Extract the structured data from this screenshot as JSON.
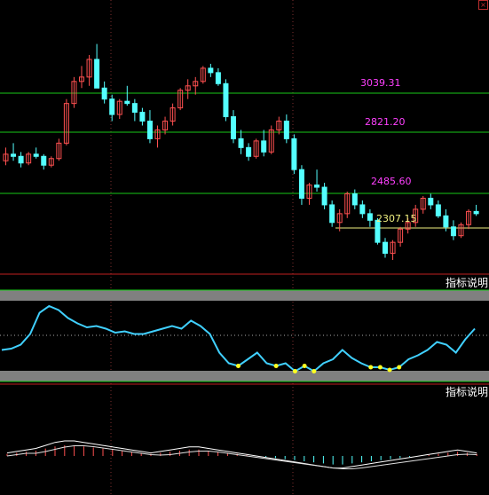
{
  "colors": {
    "background": "#000000",
    "up_candle": "#ff5050",
    "down_candle": "#54ffff",
    "support_line": "#18c818",
    "level_label": "#ff40ff",
    "current_line": "#f0f080",
    "current_label": "#f0f080",
    "panel_border": "#c02020",
    "indicator_line": "#40d0ff",
    "indicator_highlight": "#ffff20",
    "gray_band": "#808080",
    "macd_white": "#ffffff"
  },
  "window": {
    "close_icon": "close-icon"
  },
  "main_panel": {
    "price_levels": [
      {
        "label": "3039.31"
      },
      {
        "label": "2821.20"
      },
      {
        "label": "2485.60"
      }
    ],
    "current_level": {
      "label": "2307.15"
    }
  },
  "indicator_panel_1": {
    "label": "指标说明"
  },
  "indicator_panel_2": {
    "label": "指标说明"
  },
  "chart_data": [
    {
      "type": "candlestick",
      "horizontal_lines": [
        3039.31,
        2821.2,
        2485.6,
        2307.15
      ],
      "grid": true,
      "candles": [
        [
          2620,
          2680,
          2600,
          2650
        ],
        [
          2650,
          2700,
          2620,
          2640
        ],
        [
          2640,
          2660,
          2590,
          2610
        ],
        [
          2610,
          2660,
          2600,
          2650
        ],
        [
          2650,
          2680,
          2630,
          2640
        ],
        [
          2640,
          2650,
          2580,
          2600
        ],
        [
          2600,
          2640,
          2590,
          2630
        ],
        [
          2630,
          2720,
          2620,
          2700
        ],
        [
          2700,
          2900,
          2690,
          2880
        ],
        [
          2880,
          3000,
          2860,
          2980
        ],
        [
          2980,
          3050,
          2950,
          3000
        ],
        [
          3000,
          3100,
          2960,
          3080
        ],
        [
          3080,
          3150,
          3020,
          2950
        ],
        [
          2950,
          2980,
          2880,
          2900
        ],
        [
          2900,
          2920,
          2800,
          2830
        ],
        [
          2830,
          2900,
          2810,
          2890
        ],
        [
          2890,
          2960,
          2870,
          2880
        ],
        [
          2880,
          2900,
          2800,
          2840
        ],
        [
          2840,
          2860,
          2780,
          2800
        ],
        [
          2800,
          2850,
          2700,
          2720
        ],
        [
          2720,
          2780,
          2680,
          2760
        ],
        [
          2760,
          2820,
          2740,
          2800
        ],
        [
          2800,
          2880,
          2780,
          2860
        ],
        [
          2860,
          2950,
          2850,
          2940
        ],
        [
          2940,
          2990,
          2900,
          2960
        ],
        [
          2960,
          3000,
          2920,
          2980
        ],
        [
          2980,
          3050,
          2970,
          3040
        ],
        [
          3040,
          3060,
          3000,
          3020
        ],
        [
          3020,
          3040,
          2960,
          2970
        ],
        [
          2970,
          2990,
          2800,
          2820
        ],
        [
          2820,
          2850,
          2700,
          2720
        ],
        [
          2720,
          2760,
          2650,
          2680
        ],
        [
          2680,
          2700,
          2620,
          2640
        ],
        [
          2640,
          2720,
          2630,
          2710
        ],
        [
          2710,
          2760,
          2640,
          2660
        ],
        [
          2660,
          2780,
          2650,
          2760
        ],
        [
          2760,
          2820,
          2740,
          2800
        ],
        [
          2800,
          2830,
          2700,
          2720
        ],
        [
          2720,
          2740,
          2560,
          2580
        ],
        [
          2580,
          2600,
          2420,
          2450
        ],
        [
          2450,
          2520,
          2420,
          2510
        ],
        [
          2510,
          2580,
          2480,
          2500
        ],
        [
          2500,
          2520,
          2400,
          2420
        ],
        [
          2420,
          2440,
          2320,
          2340
        ],
        [
          2340,
          2400,
          2300,
          2380
        ],
        [
          2380,
          2480,
          2360,
          2470
        ],
        [
          2470,
          2490,
          2400,
          2420
        ],
        [
          2420,
          2440,
          2360,
          2380
        ],
        [
          2380,
          2400,
          2320,
          2350
        ],
        [
          2350,
          2360,
          2240,
          2250
        ],
        [
          2250,
          2270,
          2180,
          2200
        ],
        [
          2200,
          2260,
          2170,
          2250
        ],
        [
          2250,
          2320,
          2230,
          2310
        ],
        [
          2310,
          2360,
          2290,
          2340
        ],
        [
          2340,
          2420,
          2320,
          2400
        ],
        [
          2400,
          2460,
          2380,
          2450
        ],
        [
          2450,
          2470,
          2400,
          2420
        ],
        [
          2420,
          2440,
          2360,
          2370
        ],
        [
          2370,
          2400,
          2300,
          2320
        ],
        [
          2320,
          2350,
          2260,
          2280
        ],
        [
          2280,
          2340,
          2270,
          2330
        ],
        [
          2330,
          2400,
          2310,
          2390
        ],
        [
          2390,
          2420,
          2370,
          2380
        ]
      ]
    },
    {
      "type": "line",
      "series": [
        {
          "values": [
            62,
            63,
            66,
            74,
            90,
            95,
            92,
            86,
            82,
            79,
            80,
            78,
            75,
            76,
            74,
            74,
            76,
            78,
            80,
            78,
            84,
            80,
            74,
            60,
            52,
            50,
            55,
            60,
            52,
            50,
            52,
            46,
            50,
            46,
            52,
            55,
            62,
            56,
            52,
            49,
            49,
            47,
            49,
            55,
            58,
            62,
            68,
            66,
            60,
            70,
            78
          ]
        }
      ]
    },
    {
      "type": "bar",
      "series": [
        {
          "values": [
            2,
            3,
            4,
            5,
            7,
            9,
            10,
            10,
            9,
            8,
            7,
            6,
            5,
            4,
            3,
            2,
            3,
            4,
            5,
            6,
            6,
            5,
            4,
            3,
            2,
            1,
            0,
            -1,
            -2,
            -3,
            -4,
            -5,
            -6,
            -7,
            -8,
            -8,
            -7,
            -6,
            -5,
            -4,
            -3,
            -2,
            -1,
            0,
            1,
            2,
            3,
            4,
            3,
            2
          ]
        }
      ]
    }
  ]
}
